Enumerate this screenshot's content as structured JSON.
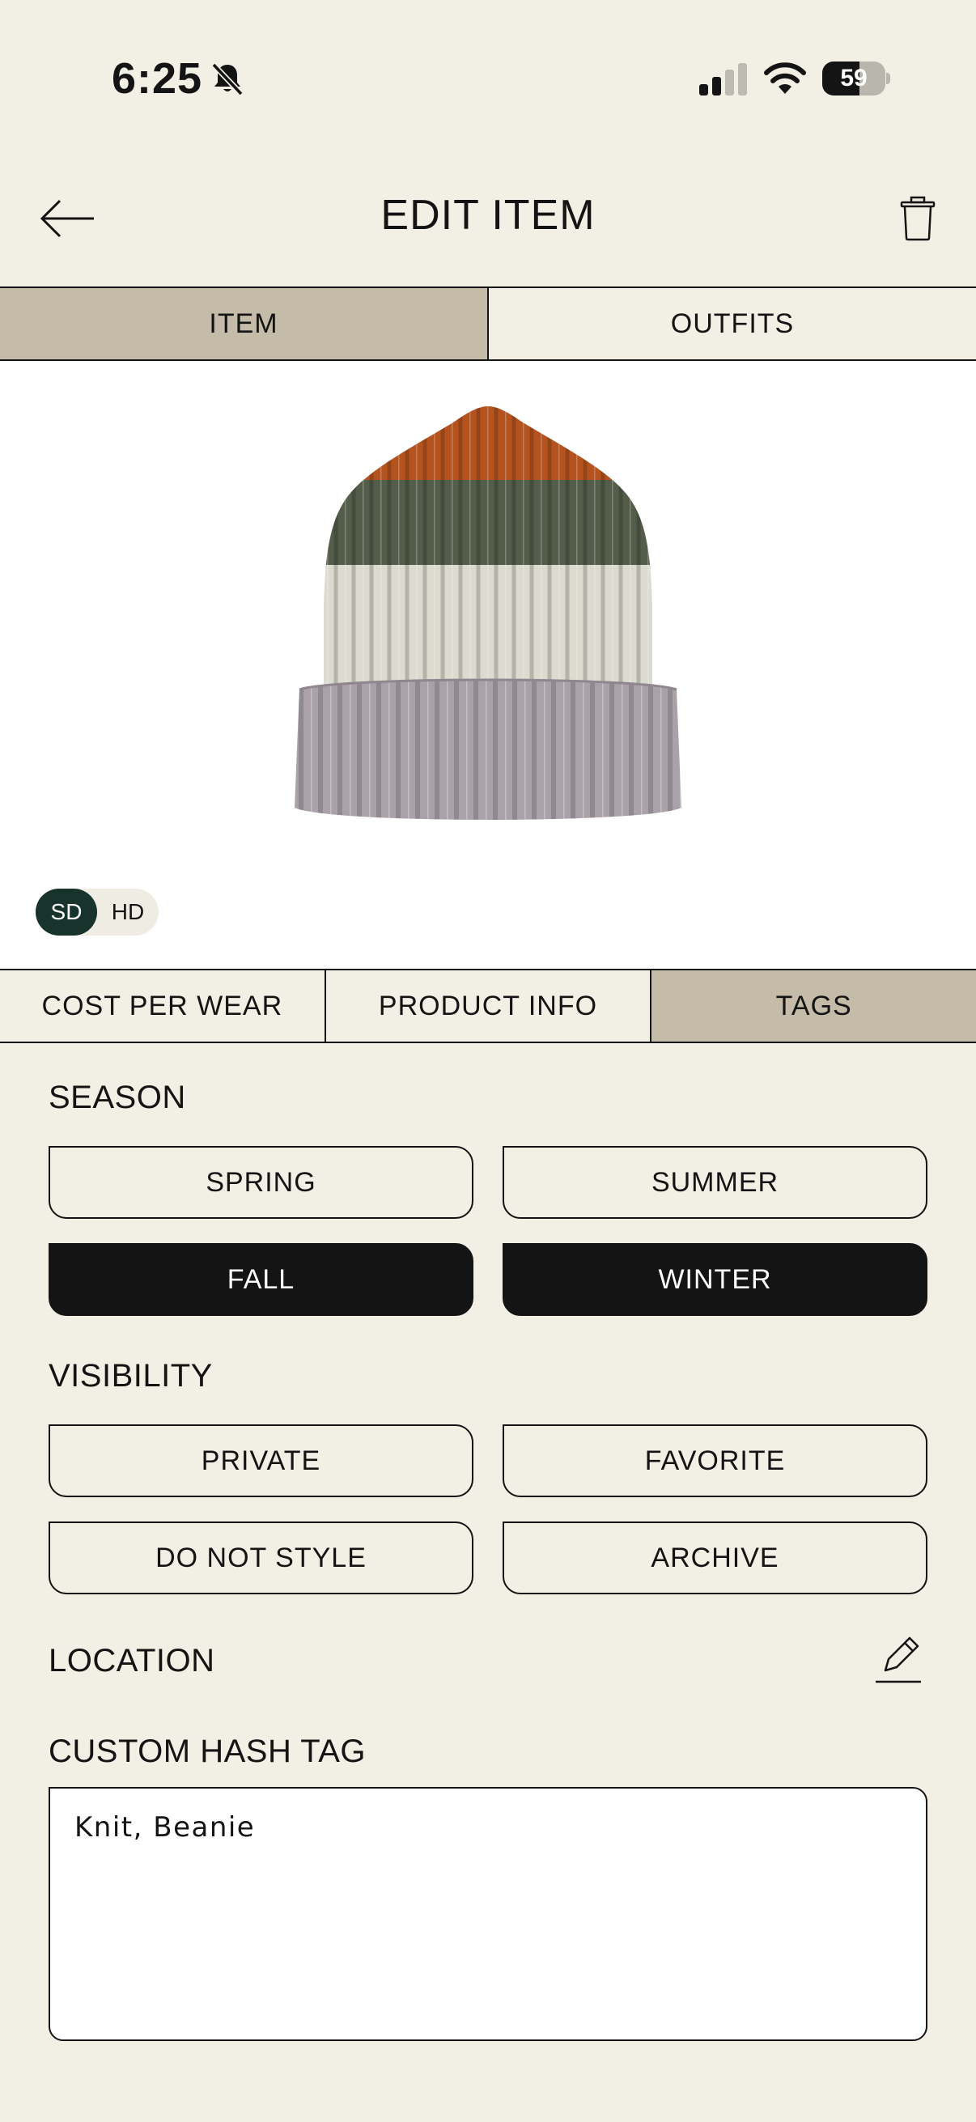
{
  "status_bar": {
    "time": "6:25",
    "battery_level": "59",
    "battery_fraction": 0.59,
    "icons": [
      "bell-slash-icon",
      "cellular-signal-icon",
      "wifi-icon",
      "battery-icon"
    ]
  },
  "header": {
    "title": "EDIT ITEM",
    "back_icon": "arrow-left-icon",
    "delete_icon": "trash-icon"
  },
  "main_tabs": [
    {
      "label": "ITEM",
      "active": true
    },
    {
      "label": "OUTFITS",
      "active": false
    }
  ],
  "image_quality": {
    "options": [
      "SD",
      "HD"
    ],
    "selected": "SD"
  },
  "sub_tabs": [
    {
      "label": "COST PER WEAR",
      "active": false
    },
    {
      "label": "PRODUCT INFO",
      "active": false
    },
    {
      "label": "TAGS",
      "active": true
    }
  ],
  "season": {
    "label": "SEASON",
    "options": [
      {
        "label": "SPRING",
        "selected": false
      },
      {
        "label": "SUMMER",
        "selected": false
      },
      {
        "label": "FALL",
        "selected": true
      },
      {
        "label": "WINTER",
        "selected": true
      }
    ]
  },
  "visibility": {
    "label": "VISIBILITY",
    "options": [
      {
        "label": "PRIVATE",
        "selected": false
      },
      {
        "label": "FAVORITE",
        "selected": false
      },
      {
        "label": "DO NOT STYLE",
        "selected": false
      },
      {
        "label": "ARCHIVE",
        "selected": false
      }
    ]
  },
  "location": {
    "label": "LOCATION",
    "edit_icon": "pencil-icon"
  },
  "custom_hash_tag": {
    "label": "CUSTOM HASH TAG",
    "value": "Knit, Beanie"
  },
  "colors": {
    "background": "#f2efe4",
    "active_tab": "#c4bca8",
    "selected_pill": "#141414",
    "sd_toggle": "#17332c"
  }
}
